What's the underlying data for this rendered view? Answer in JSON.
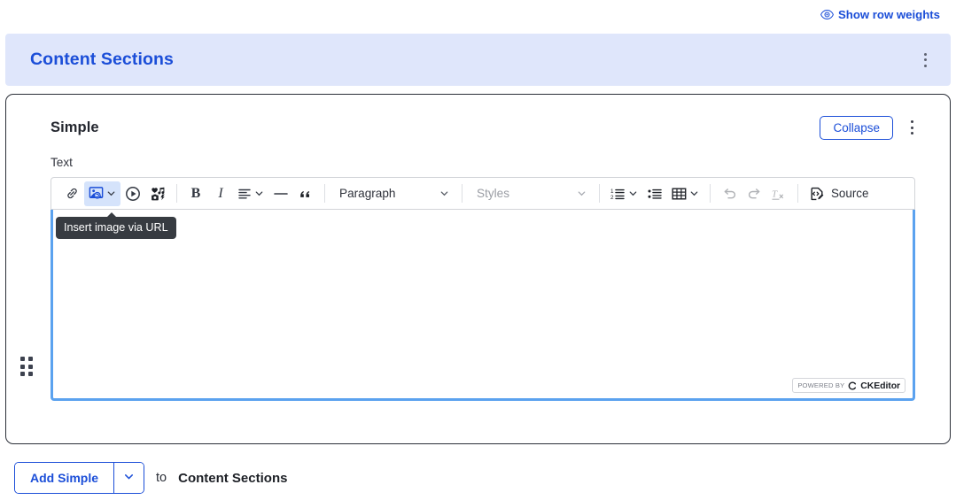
{
  "top": {
    "show_row_weights": "Show row weights",
    "eye_icon": "eye-icon"
  },
  "sections": {
    "title": "Content Sections",
    "menu_icon": "kebab-menu-icon"
  },
  "card": {
    "title": "Simple",
    "collapse_label": "Collapse",
    "menu_icon": "kebab-menu-icon",
    "drag_icon": "drag-handle-icon",
    "field_label": "Text"
  },
  "editor": {
    "tooltip": "Insert image via URL",
    "paragraph_dropdown": "Paragraph",
    "styles_dropdown": "Styles",
    "source_label": "Source",
    "bold_label": "B",
    "italic_label": "I",
    "powered_by": "POWERED BY",
    "brand": "CKEditor",
    "buttons": [
      {
        "name": "link-icon",
        "title": "Link"
      },
      {
        "name": "insert-image-icon",
        "title": "Insert image via URL"
      },
      {
        "name": "media-embed-icon",
        "title": "Insert media"
      },
      {
        "name": "media-gallery-icon",
        "title": "Media library"
      },
      {
        "name": "bold-icon",
        "title": "Bold"
      },
      {
        "name": "italic-icon",
        "title": "Italic"
      },
      {
        "name": "text-alignment-icon",
        "title": "Text alignment"
      },
      {
        "name": "horizontal-line-icon",
        "title": "Horizontal line"
      },
      {
        "name": "block-quote-icon",
        "title": "Block quote"
      },
      {
        "name": "numbered-list-icon",
        "title": "Numbered List"
      },
      {
        "name": "bulleted-list-icon",
        "title": "Bulleted List"
      },
      {
        "name": "insert-table-icon",
        "title": "Insert table"
      },
      {
        "name": "undo-icon",
        "title": "Undo"
      },
      {
        "name": "redo-icon",
        "title": "Redo"
      },
      {
        "name": "remove-format-icon",
        "title": "Remove format"
      },
      {
        "name": "source-icon",
        "title": "Source"
      }
    ],
    "content": ""
  },
  "bottom": {
    "add_label": "Add Simple",
    "dropdown_icon": "chevron-down-icon",
    "to_word": "to",
    "target": "Content Sections"
  },
  "colors": {
    "accent_blue": "#1b4ed8",
    "banner_bg": "#dfe6fb",
    "focus_border": "#5ba2ef",
    "active_btn_bg": "#d5e3fb",
    "tooltip_bg": "#373b41"
  }
}
